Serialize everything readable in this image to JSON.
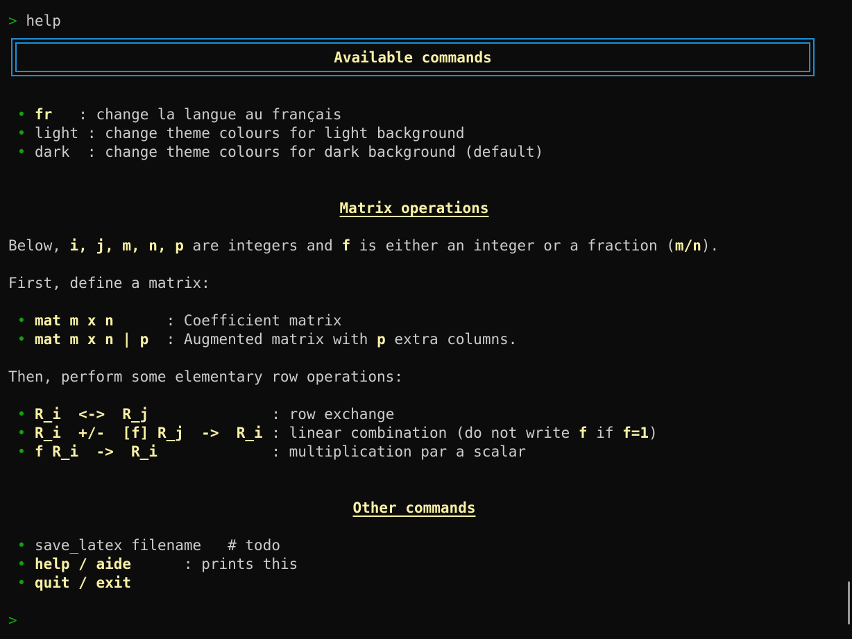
{
  "prompt_symbol": ">",
  "command_entered": "help",
  "header": {
    "title": "Available commands"
  },
  "bullet_glyph": "•",
  "general": [
    {
      "key": "fr",
      "pad": "  ",
      "sep": " : ",
      "desc": "change la langue au français"
    },
    {
      "key": "light",
      "pad": "",
      "sep": " : ",
      "desc": "change theme colours for light background"
    },
    {
      "key": "dark",
      "pad": " ",
      "sep": " : ",
      "desc": "change theme colours for dark background (default)"
    }
  ],
  "matrix": {
    "heading": "Matrix operations",
    "intro": {
      "p1": "Below, ",
      "vars": "i, j, m, n, p",
      "p2": " are integers and ",
      "f": "f",
      "p3": " is either an integer or a fraction (",
      "frac": "m/n",
      "p4": ")."
    },
    "define_text": "First, define a matrix:",
    "define_items": [
      {
        "cmd": "mat m x n",
        "pad": "      ",
        "sep": ": ",
        "desc": "Coefficient matrix"
      },
      {
        "cmd": "mat m x n | p",
        "pad": "  ",
        "sep": ": ",
        "desc_a": "Augmented matrix with ",
        "desc_p": "p",
        "desc_b": " extra columns."
      }
    ],
    "ops_text": "Then, perform some elementary row operations:",
    "ops_items": [
      {
        "cmd": "R_i  <->  R_j",
        "pad": "              ",
        "sep": ": ",
        "desc": "row exchange"
      },
      {
        "cmd": "R_i  +/-  [f] R_j  ->  R_i",
        "pad": " ",
        "sep": ": ",
        "desc_a": "linear combination (do not write ",
        "desc_f": "f",
        "desc_b": " if ",
        "desc_f1": "f=1",
        "desc_c": ")"
      },
      {
        "cmd": "f R_i  ->  R_i",
        "pad": "             ",
        "sep": ": ",
        "desc": "multiplication par a scalar"
      }
    ]
  },
  "other": {
    "heading": "Other commands",
    "items": [
      {
        "text": "save_latex filename   # todo"
      },
      {
        "cmd": "help / aide",
        "pad": "      ",
        "sep": ": ",
        "desc": "prints this"
      },
      {
        "cmd": "quit / exit"
      }
    ]
  },
  "colors": {
    "prompt": "#13a10e",
    "highlight": "#f9f1a5",
    "border": "#1a8fd8",
    "text": "#cccccc",
    "background": "#0c0c0c"
  }
}
